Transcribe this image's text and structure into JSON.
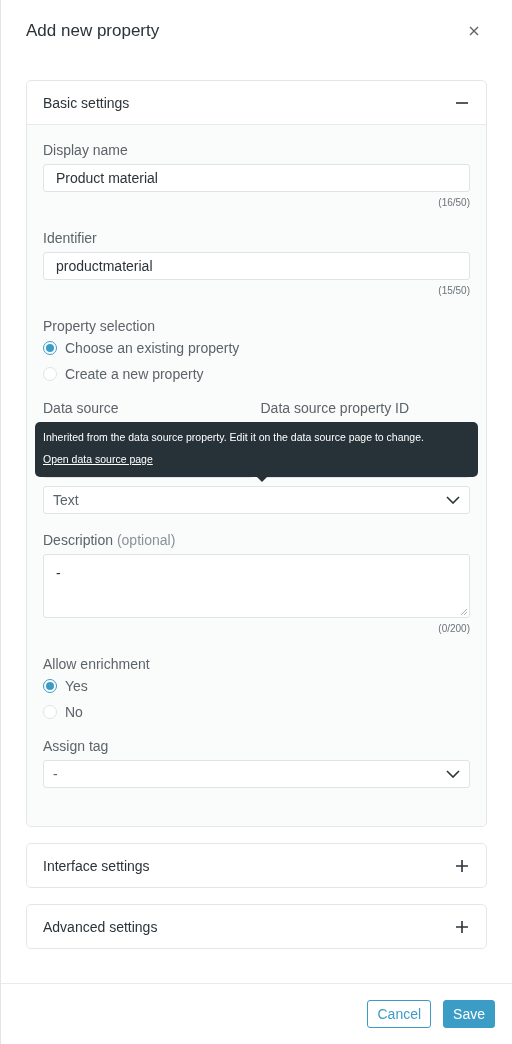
{
  "dialog": {
    "title": "Add new property"
  },
  "sections": [
    {
      "title": "Basic settings",
      "expanded": true,
      "fields": [
        {
          "kind": "text",
          "label": "Display name",
          "value": "Product material",
          "counter": "(16/50)"
        },
        {
          "kind": "text",
          "label": "Identifier",
          "value": "productmaterial",
          "counter": "(15/50)"
        },
        {
          "kind": "radio",
          "label": "Property selection",
          "options": [
            {
              "label": "Choose an existing property",
              "selected": true
            },
            {
              "label": "Create a new property",
              "selected": false
            }
          ]
        },
        {
          "kind": "pair",
          "columns": [
            {
              "label": "Data source"
            },
            {
              "label": "Data source property ID"
            }
          ],
          "tooltip": {
            "text": "Inherited from the data source property. Edit it on the data source page to change.",
            "link": "Open data source page"
          }
        },
        {
          "kind": "select",
          "value": "Text"
        },
        {
          "kind": "textarea",
          "label": "Description",
          "hint": "(optional)",
          "value": "-",
          "counter": "(0/200)"
        },
        {
          "kind": "radio",
          "label": "Allow enrichment",
          "options": [
            {
              "label": "Yes",
              "selected": true
            },
            {
              "label": "No",
              "selected": false
            }
          ]
        },
        {
          "kind": "select",
          "label": "Assign tag",
          "value": "-"
        }
      ]
    },
    {
      "title": "Interface settings",
      "expanded": false
    },
    {
      "title": "Advanced settings",
      "expanded": false
    }
  ],
  "buttons": [
    {
      "label": "Cancel",
      "kind": "secondary"
    },
    {
      "label": "Save",
      "kind": "primary"
    }
  ]
}
